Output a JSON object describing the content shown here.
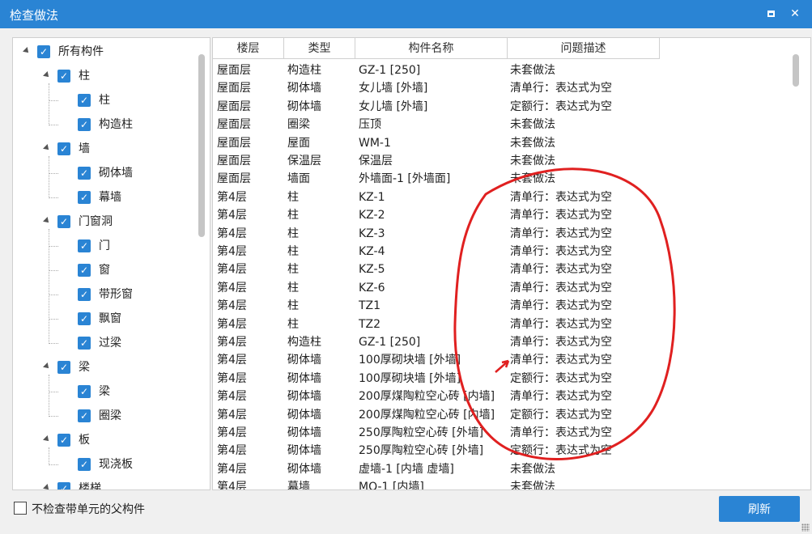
{
  "window": {
    "title": "检查做法",
    "maximize_icon": "maximize-icon",
    "close_icon": "close-icon",
    "close_glyph": "✕"
  },
  "tree": {
    "items": [
      {
        "label": "所有构件",
        "level": 0,
        "expander": true
      },
      {
        "label": "柱",
        "level": 1,
        "expander": true
      },
      {
        "label": "柱",
        "level": 2,
        "expander": false
      },
      {
        "label": "构造柱",
        "level": 2,
        "expander": false
      },
      {
        "label": "墙",
        "level": 1,
        "expander": true
      },
      {
        "label": "砌体墙",
        "level": 2,
        "expander": false
      },
      {
        "label": "幕墙",
        "level": 2,
        "expander": false
      },
      {
        "label": "门窗洞",
        "level": 1,
        "expander": true
      },
      {
        "label": "门",
        "level": 2,
        "expander": false
      },
      {
        "label": "窗",
        "level": 2,
        "expander": false
      },
      {
        "label": "带形窗",
        "level": 2,
        "expander": false
      },
      {
        "label": "飘窗",
        "level": 2,
        "expander": false
      },
      {
        "label": "过梁",
        "level": 2,
        "expander": false
      },
      {
        "label": "梁",
        "level": 1,
        "expander": true
      },
      {
        "label": "梁",
        "level": 2,
        "expander": false
      },
      {
        "label": "圈梁",
        "level": 2,
        "expander": false
      },
      {
        "label": "板",
        "level": 1,
        "expander": true
      },
      {
        "label": "现浇板",
        "level": 2,
        "expander": false
      },
      {
        "label": "楼梯",
        "level": 1,
        "expander": true
      }
    ],
    "check_glyph": "✓"
  },
  "table": {
    "columns": [
      "楼层",
      "类型",
      "构件名称",
      "问题描述"
    ],
    "rows": [
      [
        "屋面层",
        "构造柱",
        "GZ-1 [250]",
        "未套做法"
      ],
      [
        "屋面层",
        "砌体墙",
        "女儿墙 [外墙]",
        "清单行：表达式为空"
      ],
      [
        "屋面层",
        "砌体墙",
        "女儿墙 [外墙]",
        "定额行：表达式为空"
      ],
      [
        "屋面层",
        "圈梁",
        "压顶",
        "未套做法"
      ],
      [
        "屋面层",
        "屋面",
        "WM-1",
        "未套做法"
      ],
      [
        "屋面层",
        "保温层",
        "保温层",
        "未套做法"
      ],
      [
        "屋面层",
        "墙面",
        "外墙面-1 [外墙面]",
        "未套做法"
      ],
      [
        "第4层",
        "柱",
        "KZ-1",
        "清单行：表达式为空"
      ],
      [
        "第4层",
        "柱",
        "KZ-2",
        "清单行：表达式为空"
      ],
      [
        "第4层",
        "柱",
        "KZ-3",
        "清单行：表达式为空"
      ],
      [
        "第4层",
        "柱",
        "KZ-4",
        "清单行：表达式为空"
      ],
      [
        "第4层",
        "柱",
        "KZ-5",
        "清单行：表达式为空"
      ],
      [
        "第4层",
        "柱",
        "KZ-6",
        "清单行：表达式为空"
      ],
      [
        "第4层",
        "柱",
        "TZ1",
        "清单行：表达式为空"
      ],
      [
        "第4层",
        "柱",
        "TZ2",
        "清单行：表达式为空"
      ],
      [
        "第4层",
        "构造柱",
        "GZ-1 [250]",
        "清单行：表达式为空"
      ],
      [
        "第4层",
        "砌体墙",
        "100厚砌块墙 [外墙]",
        "清单行：表达式为空"
      ],
      [
        "第4层",
        "砌体墙",
        "100厚砌块墙 [外墙]",
        "定额行：表达式为空"
      ],
      [
        "第4层",
        "砌体墙",
        "200厚煤陶粒空心砖 [内墙]",
        "清单行：表达式为空"
      ],
      [
        "第4层",
        "砌体墙",
        "200厚煤陶粒空心砖 [内墙]",
        "定额行：表达式为空"
      ],
      [
        "第4层",
        "砌体墙",
        "250厚陶粒空心砖 [外墙]",
        "清单行：表达式为空"
      ],
      [
        "第4层",
        "砌体墙",
        "250厚陶粒空心砖 [外墙]",
        "定额行：表达式为空"
      ],
      [
        "第4层",
        "砌体墙",
        "虚墙-1 [内墙 虚墙]",
        "未套做法"
      ],
      [
        "第4层",
        "幕墙",
        "MQ-1 [内墙]",
        "未套做法"
      ]
    ]
  },
  "footer": {
    "checkbox_label": "不检查带单元的父构件",
    "checkbox_checked": false,
    "refresh_label": "刷新"
  },
  "colors": {
    "accent": "#2a84d4",
    "annotation": "#e02020"
  }
}
